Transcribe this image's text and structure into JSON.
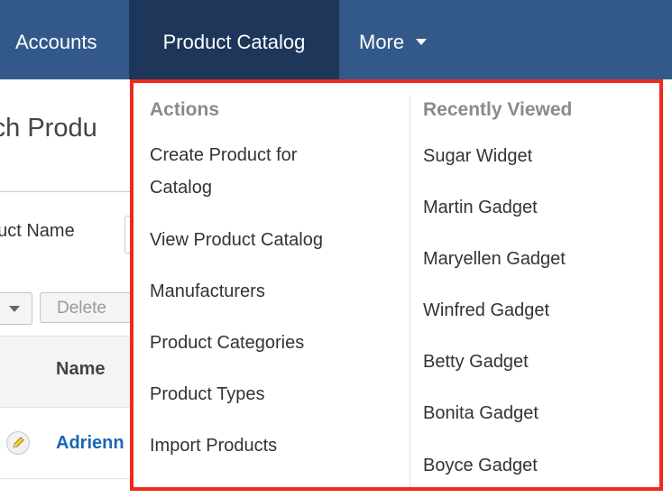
{
  "nav": {
    "accounts": "Accounts",
    "product_catalog": "Product Catalog",
    "more": "More",
    "more_icon": "caret-down-icon",
    "bar_color": "#33598b",
    "active_color": "#1d3659"
  },
  "background_page": {
    "title_fragment": "rch Produ",
    "field_label_fragment": "duct Name",
    "delete_label": "Delete",
    "name_column": "Name",
    "first_row_link_fragment": "Adrienn",
    "row_icon": "pencil-icon"
  },
  "dropdown": {
    "highlight_color": "#ee2a1c",
    "actions": {
      "heading": "Actions",
      "items": [
        {
          "line1": "Create Product for",
          "line2": "Catalog"
        },
        {
          "label": "View Product Catalog"
        },
        {
          "label": "Manufacturers"
        },
        {
          "label": "Product Categories"
        },
        {
          "label": "Product Types"
        },
        {
          "label": "Import Products"
        }
      ]
    },
    "recently_viewed": {
      "heading": "Recently Viewed",
      "items": [
        "Sugar Widget",
        "Martin Gadget",
        "Maryellen Gadget",
        "Winfred Gadget",
        "Betty Gadget",
        "Bonita Gadget",
        "Boyce Gadget"
      ]
    }
  }
}
